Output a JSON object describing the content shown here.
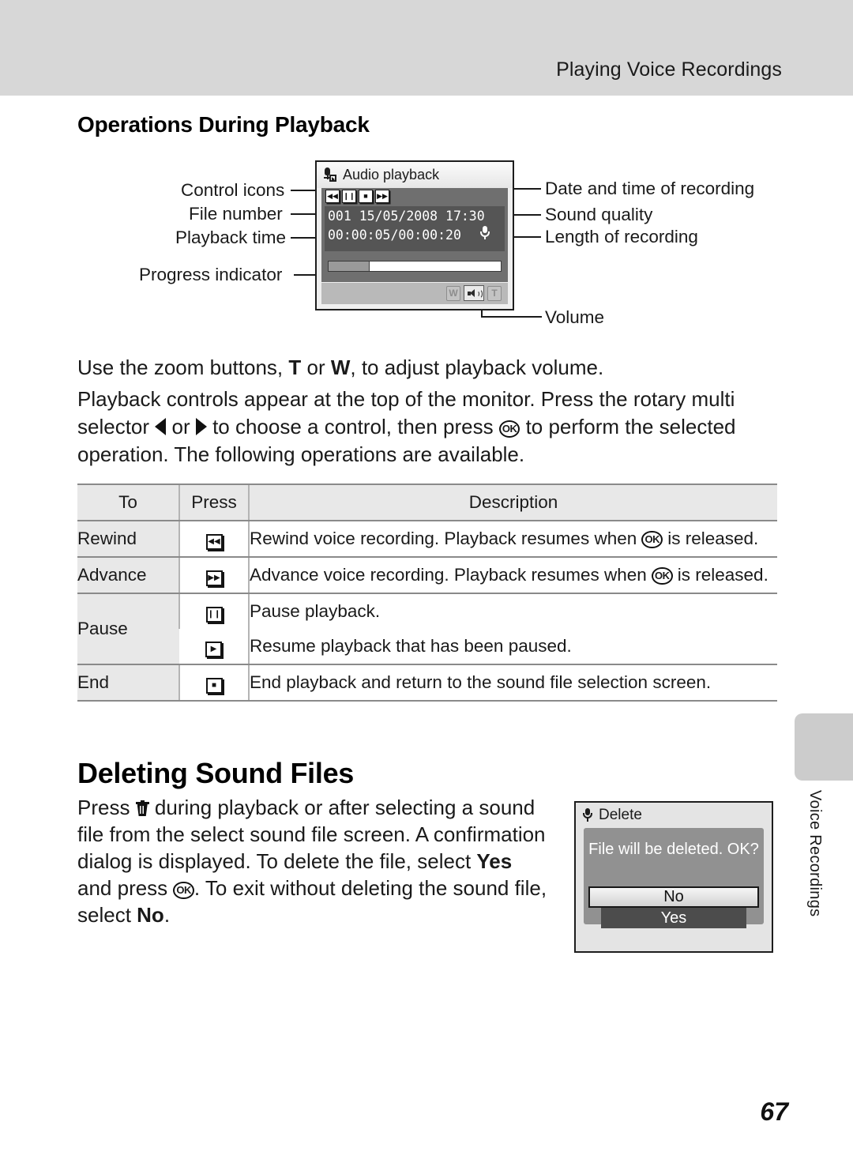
{
  "header": {
    "running_title": "Playing Voice Recordings"
  },
  "sections": {
    "operations_heading": "Operations During Playback",
    "deleting_heading": "Deleting Sound Files"
  },
  "diagram": {
    "labels_left": [
      "Control icons",
      "File number",
      "Playback time",
      "Progress indicator"
    ],
    "labels_right": [
      "Date and time of recording",
      "Sound quality",
      "Length of recording",
      "Volume"
    ],
    "monitor": {
      "title": "Audio playback",
      "title_icon": "microphone-card-icon",
      "control_icons": [
        "rewind-icon",
        "pause-icon",
        "stop-icon",
        "advance-icon"
      ],
      "control_glyphs": [
        "◀◀",
        "❙❙",
        "■",
        "▶▶"
      ],
      "file_info": "001 15/05/2008 17:30",
      "times": "00:00:05/00:00:20",
      "quality_icon": "microphone-quality-icon",
      "progress_percent": 24,
      "footer_icons": [
        "wide-zoom-key",
        "volume-speaker-icon",
        "tele-zoom-key"
      ],
      "footer_labels": [
        "W",
        "T"
      ]
    }
  },
  "paragraphs": {
    "zoom_volume": {
      "p1": "Use the zoom buttons, ",
      "t": "T",
      "p2": " or ",
      "w": "W",
      "p3": ", to adjust playback volume."
    },
    "controls": {
      "p1": "Playback controls appear at the top of the monitor. Press the rotary multi selector ",
      "p2": " or ",
      "p3": " to choose a control, then press ",
      "ok": "OK",
      "p4": " to perform the selected operation. The following operations are available."
    },
    "deleting": {
      "p1": "Press ",
      "p2": " during playback or after selecting a sound file from the select sound file screen. A confirmation dialog is displayed. To delete the file, select ",
      "yes": "Yes",
      "p3": " and press ",
      "ok": "OK",
      "p4": ". To exit without deleting the sound file, select ",
      "no": "No",
      "p5": "."
    }
  },
  "table": {
    "headers": [
      "To",
      "Press",
      "Description"
    ],
    "rows": [
      {
        "to": "Rewind",
        "icon": "rewind-icon",
        "glyph": "◀◀",
        "desc_before": "Rewind voice recording. Playback resumes when ",
        "desc_ok": "OK",
        "desc_after": " is released."
      },
      {
        "to": "Advance",
        "icon": "advance-icon",
        "glyph": "▶▶",
        "desc_before": "Advance voice recording. Playback resumes when ",
        "desc_ok": "OK",
        "desc_after": " is released."
      },
      {
        "to": "Pause",
        "icon": "pause-icon",
        "glyph": "❙❙",
        "desc_before": "Pause playback.",
        "desc_ok": "",
        "desc_after": ""
      },
      {
        "to": "",
        "icon": "play-icon",
        "glyph": "▶",
        "desc_before": "Resume playback that has been paused.",
        "desc_ok": "",
        "desc_after": ""
      },
      {
        "to": "End",
        "icon": "stop-icon",
        "glyph": "■",
        "desc_before": "End playback and return to the sound file selection screen.",
        "desc_ok": "",
        "desc_after": ""
      }
    ]
  },
  "delete_dialog": {
    "title": "Delete",
    "title_icon": "microphone-icon",
    "message": "File will be deleted. OK?",
    "option_no": "No",
    "option_yes": "Yes"
  },
  "side_tab": {
    "label": "Voice Recordings"
  },
  "footer": {
    "page_number": "67"
  },
  "colors": {
    "header_band": "#d7d7d7",
    "table_header_bg": "#e8e8e8",
    "table_border": "#8a8a8a",
    "screen_gray": "#6f6f6f",
    "screen_dark": "#555555",
    "dialog_gray": "#919191",
    "yes_bar": "#4c4c4c",
    "side_tab": "#cccccc"
  }
}
